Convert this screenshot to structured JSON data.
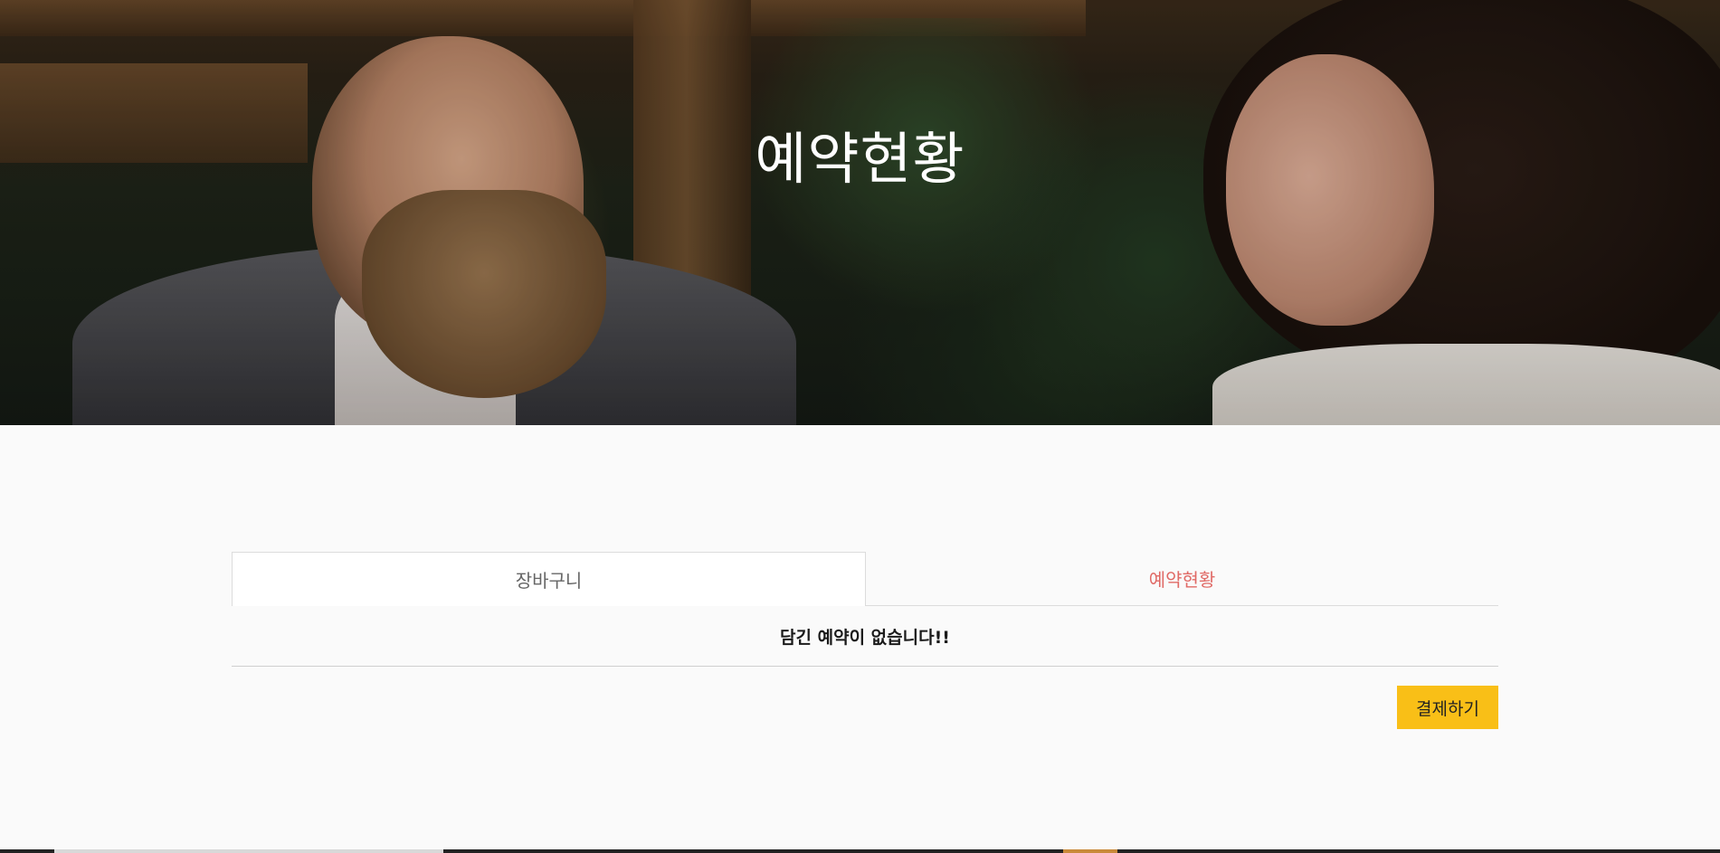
{
  "hero": {
    "title": "예약현황",
    "background_image": "couple-talking-photo"
  },
  "tabs": [
    {
      "label": "장바구니",
      "active": true
    },
    {
      "label": "예약현황",
      "active": false
    }
  ],
  "cart": {
    "empty_message": "담긴 예약이 없습니다!!"
  },
  "actions": {
    "checkout_label": "결제하기"
  },
  "colors": {
    "page_bg": "#fafafa",
    "inactive_tab_text": "#e06a66",
    "checkout_button": "#f9bf17"
  }
}
